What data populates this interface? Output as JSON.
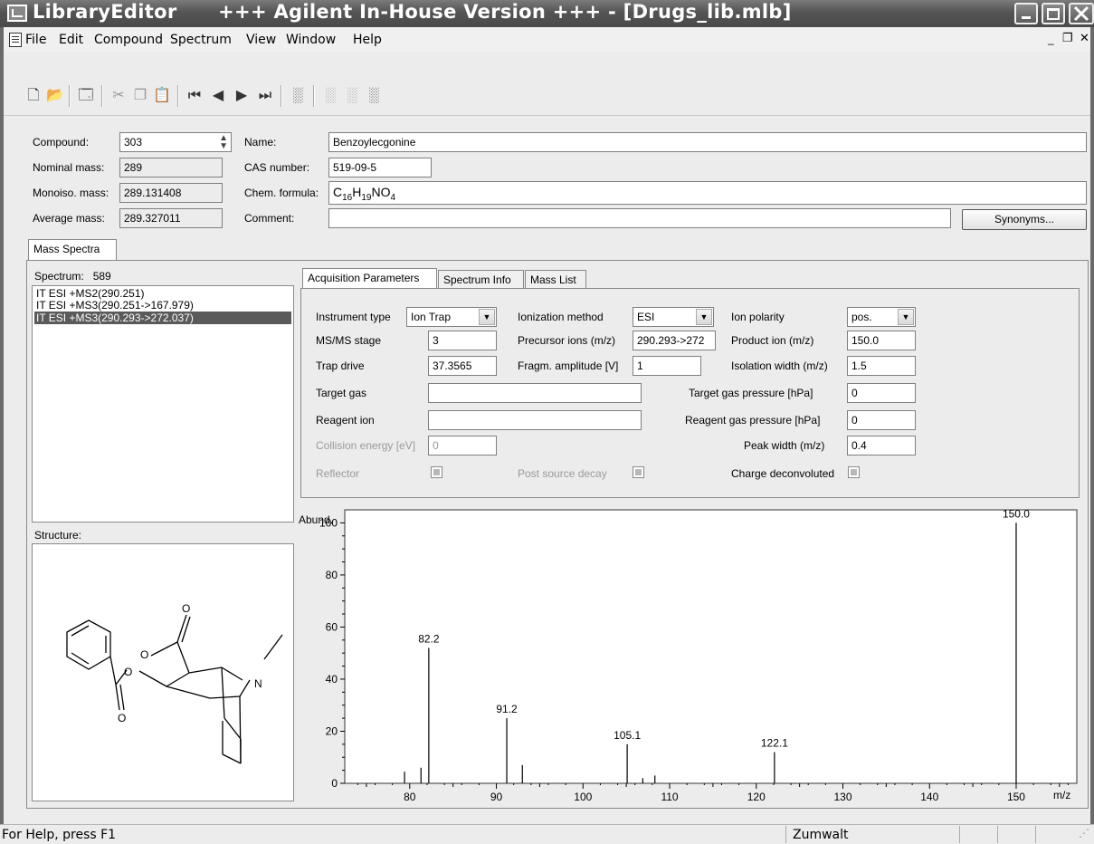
{
  "window": {
    "title": "LibraryEditor      +++ Agilent In-House Version +++ - [Drugs_lib.mlb]"
  },
  "menu": {
    "items": [
      "File",
      "Edit",
      "Compound",
      "Spectrum",
      "View",
      "Window",
      "Help"
    ]
  },
  "compound": {
    "compound_label": "Compound:",
    "compound_value": "303",
    "nominal_mass_label": "Nominal mass:",
    "nominal_mass_value": "289",
    "monoiso_mass_label": "Monoiso. mass:",
    "monoiso_mass_value": "289.131408",
    "average_mass_label": "Average mass:",
    "average_mass_value": "289.327011",
    "name_label": "Name:",
    "name_value": "Benzoylecgonine",
    "cas_label": "CAS number:",
    "cas_value": "519-09-5",
    "formula_label": "Chem. formula:",
    "formula_parts": {
      "c": "C",
      "c_sub": "16",
      "h": "H",
      "h_sub": "19",
      "no": "NO",
      "o_sub": "4"
    },
    "comment_label": "Comment:",
    "comment_value": "",
    "synonyms_button": "Synonyms..."
  },
  "tabs": {
    "mass_spectra": "Mass Spectra",
    "acquisition": "Acquisition Parameters",
    "spectrum_info": "Spectrum Info",
    "mass_list": "Mass List"
  },
  "spectrum_list": {
    "label": "Spectrum:",
    "count": "589",
    "items": [
      "IT ESI +MS2(290.251)",
      "IT ESI +MS3(290.251->167.979)",
      "IT ESI +MS3(290.293->272.037)"
    ],
    "selected_index": 2
  },
  "acquisition": {
    "instrument_type_label": "Instrument type",
    "instrument_type_value": "Ion Trap",
    "ionization_method_label": "Ionization method",
    "ionization_method_value": "ESI",
    "ion_polarity_label": "Ion polarity",
    "ion_polarity_value": "pos.",
    "msms_stage_label": "MS/MS stage",
    "msms_stage_value": "3",
    "precursor_label": "Precursor ions (m/z)",
    "precursor_value": "290.293->272",
    "product_ion_label": "Product ion (m/z)",
    "product_ion_value": "150.0",
    "trap_drive_label": "Trap drive",
    "trap_drive_value": "37.3565",
    "fragm_amplitude_label": "Fragm. amplitude [V]",
    "fragm_amplitude_value": "1",
    "isolation_width_label": "Isolation width (m/z)",
    "isolation_width_value": "1.5",
    "target_gas_label": "Target gas",
    "target_gas_value": "",
    "target_gas_pressure_label": "Target gas pressure [hPa]",
    "target_gas_pressure_value": "0",
    "reagent_ion_label": "Reagent ion",
    "reagent_ion_value": "",
    "reagent_gas_pressure_label": "Reagent gas pressure [hPa]",
    "reagent_gas_pressure_value": "0",
    "collision_energy_label": "Collision energy [eV]",
    "collision_energy_value": "0",
    "peak_width_label": "Peak width (m/z)",
    "peak_width_value": "0.4",
    "reflector_label": "Reflector",
    "post_source_decay_label": "Post source decay",
    "charge_deconvoluted_label": "Charge deconvoluted"
  },
  "structure": {
    "label": "Structure:",
    "atoms": {
      "o1": "O",
      "o2": "O",
      "o3": "O",
      "o4": "O",
      "n": "N"
    }
  },
  "status": {
    "help_text": "For Help, press F1",
    "user": "Zumwalt"
  },
  "chart_data": {
    "type": "bar",
    "ylabel": "Abund.",
    "xlabel": "m/z",
    "xlim": [
      72.5,
      157
    ],
    "ylim": [
      0,
      105
    ],
    "xticks": [
      80,
      90,
      100,
      110,
      120,
      130,
      140,
      150
    ],
    "yticks": [
      0,
      20,
      40,
      60,
      80,
      100
    ],
    "peaks": [
      {
        "x": 79.4,
        "y": 4.5
      },
      {
        "x": 81.3,
        "y": 6
      },
      {
        "x": 82.2,
        "y": 52,
        "label": "82.2"
      },
      {
        "x": 91.2,
        "y": 25,
        "label": "91.2"
      },
      {
        "x": 93.0,
        "y": 7
      },
      {
        "x": 105.1,
        "y": 15,
        "label": "105.1"
      },
      {
        "x": 106.9,
        "y": 2
      },
      {
        "x": 108.3,
        "y": 3
      },
      {
        "x": 122.1,
        "y": 12,
        "label": "122.1"
      },
      {
        "x": 150.0,
        "y": 100,
        "label": "150.0"
      }
    ]
  }
}
